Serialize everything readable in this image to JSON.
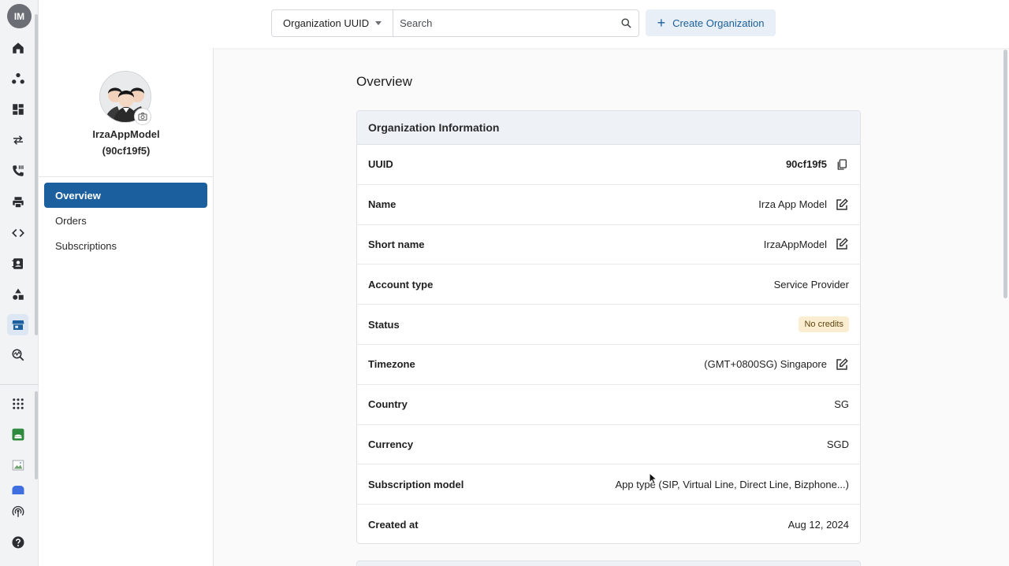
{
  "user": {
    "initials": "IM"
  },
  "header": {
    "search_scope": "Organization UUID",
    "search_placeholder": "Search",
    "create_label": "Create Organization",
    "accent": "#1c5f9e"
  },
  "organization": {
    "display_name": "IrzaAppModel",
    "display_id": "(90cf19f5)"
  },
  "subnav": {
    "items": [
      {
        "label": "Overview",
        "active": true
      },
      {
        "label": "Orders",
        "active": false
      },
      {
        "label": "Subscriptions",
        "active": false
      }
    ]
  },
  "page": {
    "title": "Overview"
  },
  "info_card": {
    "title": "Organization Information",
    "rows": [
      {
        "label": "UUID",
        "value": "90cf19f5",
        "action": "copy-icon"
      },
      {
        "label": "Name",
        "value": "Irza App Model",
        "action": "edit-icon"
      },
      {
        "label": "Short name",
        "value": "IrzaAppModel",
        "action": "edit-icon"
      },
      {
        "label": "Account type",
        "value": "Service Provider"
      },
      {
        "label": "Status",
        "value": "No credits",
        "badge_color": "#fbedcf"
      },
      {
        "label": "Timezone",
        "value": "(GMT+0800SG) Singapore",
        "action": "edit-icon"
      },
      {
        "label": "Country",
        "value": "SG"
      },
      {
        "label": "Currency",
        "value": "SGD"
      },
      {
        "label": "Subscription model",
        "value": "App type (SIP, Virtual Line, Direct Line, Bizphone...)"
      },
      {
        "label": "Created at",
        "value": "Aug 12, 2024"
      }
    ]
  },
  "rail_icons": [
    "home-icon",
    "network-icon",
    "dashboard-icon",
    "transfer-icon",
    "phone-call-icon",
    "printer-icon",
    "code-icon",
    "contacts-icon",
    "shapes-icon",
    "store-icon",
    "analytics-icon",
    "apps-grid-icon",
    "android-app-icon",
    "image-icon",
    "app-icon",
    "broadcast-icon",
    "help-icon"
  ]
}
